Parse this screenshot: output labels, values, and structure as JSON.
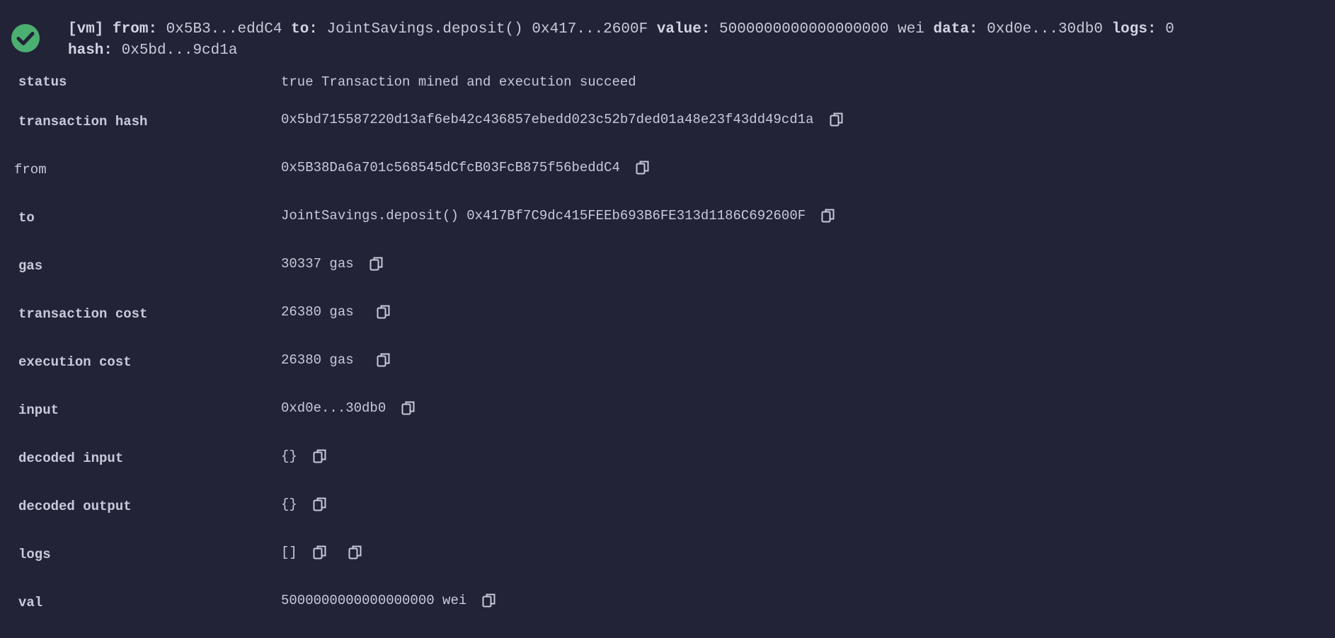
{
  "header": {
    "status_icon": "check-circle-icon",
    "accent_color": "#4caf72",
    "vm_tag": "[vm]",
    "from_label": "from:",
    "from_value": "0x5B3...eddC4",
    "to_label": "to:",
    "to_value": "JointSavings.deposit() 0x417...2600F",
    "value_label": "value:",
    "value_value": "5000000000000000000 wei",
    "data_label": "data:",
    "data_value": "0xd0e...30db0",
    "logs_label": "logs:",
    "logs_value": "0",
    "hash_label": "hash:",
    "hash_value": "0x5bd...9cd1a"
  },
  "rows": [
    {
      "key": "status",
      "value": "true Transaction mined and execution succeed",
      "copy": false
    },
    {
      "key": "transaction hash",
      "value": "0x5bd715587220d13af6eb42c436857ebedd023c52b7ded01a48e23f43dd49cd1a",
      "copy": true
    },
    {
      "key": "from",
      "value": "0x5B38Da6a701c568545dCfcB03FcB875f56beddC4",
      "copy": true
    },
    {
      "key": "to",
      "value": "JointSavings.deposit() 0x417Bf7C9dc415FEEb693B6FE313d1186C692600F",
      "copy": true
    },
    {
      "key": "gas",
      "value": "30337 gas",
      "copy": true
    },
    {
      "key": "transaction cost",
      "value": "26380 gas",
      "copy": true
    },
    {
      "key": "execution cost",
      "value": "26380 gas",
      "copy": true
    },
    {
      "key": "input",
      "value": "0xd0e...30db0",
      "copy": true
    },
    {
      "key": "decoded input",
      "value": "{}",
      "copy": true
    },
    {
      "key": "decoded output",
      "value": "{}",
      "copy": true
    },
    {
      "key": "logs",
      "value": "[]",
      "copy": true
    },
    {
      "key": "val",
      "value": "5000000000000000000 wei",
      "copy": true
    }
  ],
  "icons": {
    "copy": "copy-icon"
  }
}
